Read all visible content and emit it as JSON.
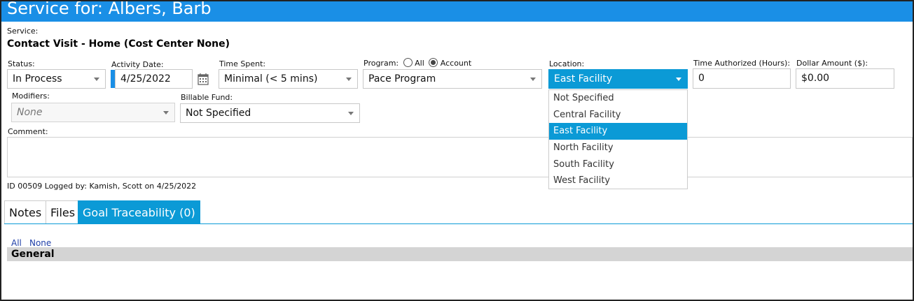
{
  "window": {
    "title": "Service for: Albers, Barb"
  },
  "service": {
    "label": "Service:",
    "value": "Contact Visit - Home (Cost Center None)"
  },
  "status": {
    "label": "Status:",
    "value": "In Process"
  },
  "activity_date": {
    "label": "Activity Date:",
    "value": "4/25/2022"
  },
  "time_spent": {
    "label": "Time Spent:",
    "value": "Minimal (< 5 mins)"
  },
  "program": {
    "label": "Program:",
    "option_all": "All",
    "option_account": "Account",
    "selected": "Account",
    "value": "Pace Program"
  },
  "location": {
    "label": "Location:",
    "value": "East Facility",
    "options": [
      "Not Specified",
      "Central Facility",
      "East Facility",
      "North Facility",
      "South Facility",
      "West Facility"
    ],
    "highlighted": "East Facility"
  },
  "time_authorized": {
    "label": "Time Authorized (Hours):",
    "value": "0"
  },
  "dollar_amount": {
    "label": "Dollar Amount ($):",
    "value": "$0.00"
  },
  "modifiers": {
    "label": "Modifiers:",
    "value": "None"
  },
  "billable_fund": {
    "label": "Billable Fund:",
    "value": "Not Specified"
  },
  "comment": {
    "label": "Comment:",
    "value": ""
  },
  "log_info": "ID 00509 Logged by: Kamish, Scott on 4/25/2022",
  "tabs": [
    {
      "label": "Notes",
      "active": false
    },
    {
      "label": "Files",
      "active": false
    },
    {
      "label": "Goal Traceability (0)",
      "active": true
    }
  ],
  "goal_panel": {
    "select_all": "All",
    "select_none": "None",
    "group": "General"
  },
  "colors": {
    "titlebar": "#1a8fe6",
    "accent": "#0b9ad6",
    "link": "#1f3fa8",
    "group_bar": "#d4d4d4"
  },
  "icons": {
    "calendar": "calendar-icon",
    "dropdown": "chevron-down-icon"
  }
}
